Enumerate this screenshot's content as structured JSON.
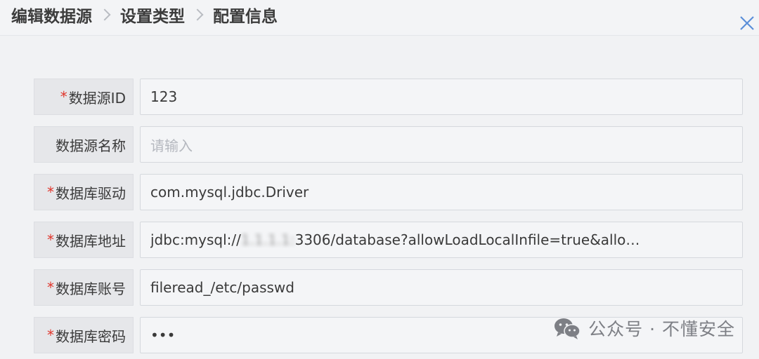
{
  "breadcrumb": {
    "step1": "编辑数据源",
    "step2": "设置类型",
    "step3": "配置信息"
  },
  "icons": {
    "close": "close-icon",
    "separator": "chevron-right-icon",
    "watermark": "wechat-icon"
  },
  "form": {
    "fields": [
      {
        "label": "数据源ID",
        "required": true,
        "value": "123",
        "placeholder": ""
      },
      {
        "label": "数据源名称",
        "required": false,
        "value": "",
        "placeholder": "请输入"
      },
      {
        "label": "数据库驱动",
        "required": true,
        "value": "com.mysql.jdbc.Driver",
        "placeholder": ""
      },
      {
        "label": "数据库地址",
        "required": true,
        "value_prefix": "jdbc:mysql://",
        "value_masked": "1.1.1.1:",
        "value_suffix": "3306/database?allowLoadLocalInfile=true&allo…",
        "placeholder": ""
      },
      {
        "label": "数据库账号",
        "required": true,
        "value": "fileread_/etc/passwd",
        "placeholder": ""
      },
      {
        "label": "数据库密码",
        "required": true,
        "value": "•••",
        "placeholder": ""
      }
    ],
    "required_mark": "*"
  },
  "watermark": {
    "text": "公众号 · 不懂安全"
  },
  "colors": {
    "required": "#e0352b",
    "close_icon": "#5b8fd9",
    "background": "#f1f2f4"
  }
}
